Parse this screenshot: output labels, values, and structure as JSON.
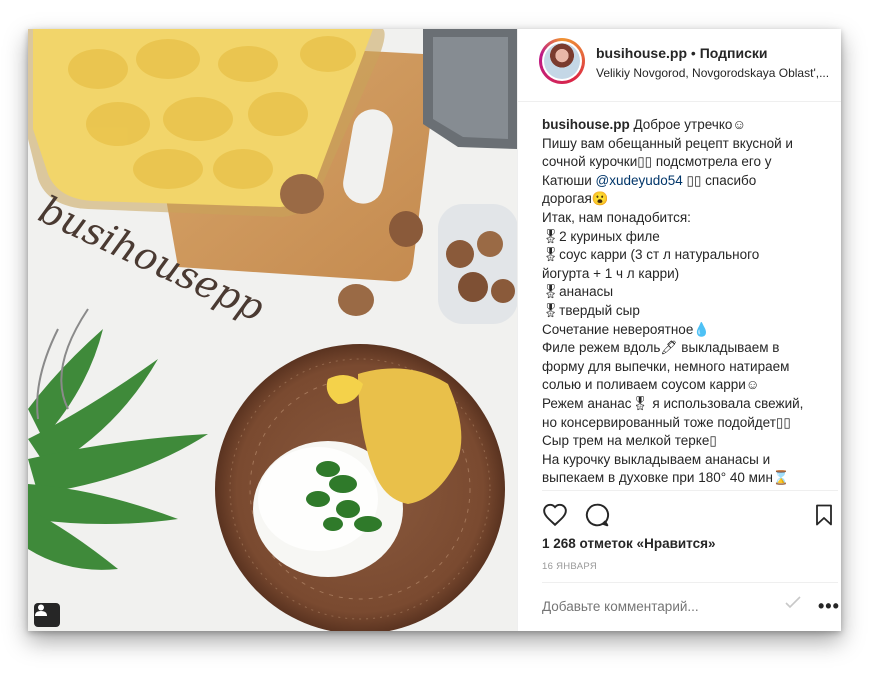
{
  "post": {
    "username": "busihouse.pp",
    "separator": "•",
    "follow_label": "Подписки",
    "location": "Velikiy Novgorod, Novgorodskaya Oblast',...",
    "caption_username": "busihouse.pp",
    "caption_lines": [
      " Доброе утречко☺",
      "Пишу вам обещанный рецепт вкусной и",
      "сочной курочки▯▯ подсмотрела его у",
      "Катюши ",
      " ▯▯ спасибо",
      "дорогая😮",
      "Итак, нам понадобится:",
      "🎖2 куриных филе",
      "🎖соус карри (3 ст л натурального",
      "йогурта + 1 ч л карри)",
      "🎖ананасы",
      "🎖твердый сыр",
      "Сочетание невероятное💧",
      "Филе режем вдоль🖊 выкладываем в",
      "форму для выпечки, немного натираем",
      "солью и поливаем соусом карри☺",
      "Режем ананас🎖 я использовала свежий,",
      "но консервированный тоже подойдет▯▯",
      "Сыр трем на мелкой терке▯",
      "На курочку выкладываем ананасы и",
      "выпекаем в духовке при 180° 40 мин⌛"
    ],
    "mention": "@xudeyudo54",
    "likes": "1 268 отметок «Нравится»",
    "date": "16 ЯНВАРЯ",
    "comment_placeholder": "Добавьте комментарий...",
    "more": "•••",
    "photo_watermark": "busihousepp",
    "icons": [
      "heart-icon",
      "comment-icon",
      "bookmark-icon",
      "person-tag-icon"
    ]
  }
}
